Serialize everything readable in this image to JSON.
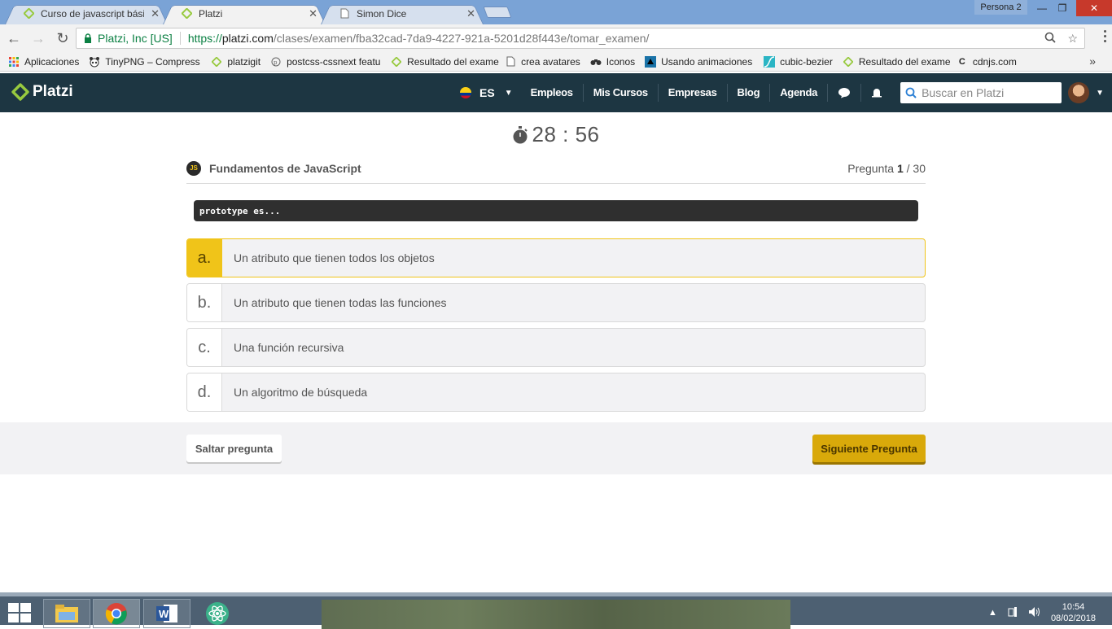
{
  "browser": {
    "tabs": [
      {
        "title": "Curso de javascript básico",
        "active": false,
        "icon": "platzi-icon"
      },
      {
        "title": "Platzi",
        "active": true,
        "icon": "platzi-icon"
      },
      {
        "title": "Simon Dice",
        "active": false,
        "icon": "page-icon"
      }
    ],
    "profile": "Persona 2",
    "url": {
      "org": "Platzi, Inc [US]",
      "scheme": "https://",
      "host": "platzi.com",
      "path": "/clases/examen/fba32cad-7da9-4227-921a-5201d28f443e/tomar_examen/"
    },
    "bookmarks": [
      {
        "label": "Aplicaciones",
        "icon": "apps-grid-icon"
      },
      {
        "label": "TinyPNG – Compress",
        "icon": "panda-icon"
      },
      {
        "label": "platzigit",
        "icon": "platzi-icon"
      },
      {
        "label": "postcss-cssnext featu",
        "icon": "postcss-icon"
      },
      {
        "label": "Resultado del exame",
        "icon": "platzi-icon"
      },
      {
        "label": "crea avatares",
        "icon": "page-icon"
      },
      {
        "label": "Iconos",
        "icon": "binoculars-icon"
      },
      {
        "label": "Usando animaciones",
        "icon": "mdn-icon"
      },
      {
        "label": "cubic-bezier",
        "icon": "curve-icon"
      },
      {
        "label": "Resultado del exame",
        "icon": "platzi-icon"
      },
      {
        "label": "cdnjs.com",
        "icon": "cdnjs-icon"
      }
    ]
  },
  "header": {
    "logo": "Platzi",
    "lang": "ES",
    "nav": [
      "Empleos",
      "Mis Cursos",
      "Empresas",
      "Blog",
      "Agenda"
    ],
    "search_placeholder": "Buscar en Platzi"
  },
  "exam": {
    "timer": "28 : 56",
    "course_badge": "JS",
    "course": "Fundamentos de JavaScript",
    "counter_label": "Pregunta",
    "counter_current": "1",
    "counter_total": "/ 30",
    "question": "prototype es...",
    "options": [
      {
        "letter": "a.",
        "text": "Un atributo que tienen todos los objetos",
        "selected": true
      },
      {
        "letter": "b.",
        "text": "Un atributo que tienen todas las funciones",
        "selected": false
      },
      {
        "letter": "c.",
        "text": "Una función recursiva",
        "selected": false
      },
      {
        "letter": "d.",
        "text": "Un algoritmo de búsqueda",
        "selected": false
      }
    ],
    "skip_label": "Saltar pregunta",
    "next_label": "Siguiente Pregunta"
  },
  "taskbar": {
    "time": "10:54",
    "date": "08/02/2018",
    "apps": [
      "file-explorer-icon",
      "chrome-icon",
      "word-icon",
      "atom-icon"
    ]
  },
  "colors": {
    "header_bg": "#1d3642",
    "accent": "#f0c419",
    "next_button": "#d9a90a",
    "platzi_green": "#98ca3f"
  }
}
